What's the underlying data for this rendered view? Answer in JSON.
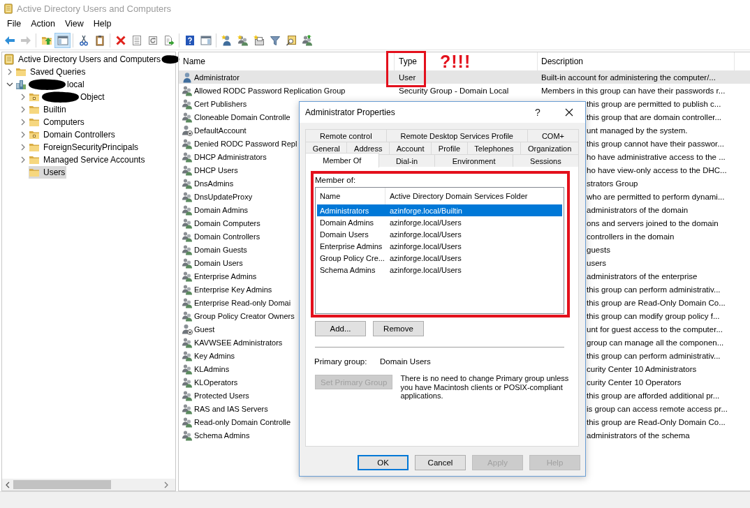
{
  "window": {
    "title": "Active Directory Users and Computers"
  },
  "menu": [
    {
      "label": "File"
    },
    {
      "label": "Action"
    },
    {
      "label": "View"
    },
    {
      "label": "Help"
    }
  ],
  "toolbar": [
    {
      "buttons": [
        {
          "kind": "back",
          "pressed": false,
          "disabled": false
        },
        {
          "kind": "forward",
          "pressed": false,
          "disabled": true
        }
      ]
    },
    {
      "buttons": [
        {
          "kind": "up",
          "pressed": false,
          "disabled": false
        },
        {
          "kind": "console_tree",
          "pressed": true,
          "disabled": false
        }
      ]
    },
    {
      "buttons": [
        {
          "kind": "cut",
          "pressed": false,
          "disabled": false
        },
        {
          "kind": "paste",
          "pressed": false,
          "disabled": false
        }
      ]
    },
    {
      "buttons": [
        {
          "kind": "delete",
          "pressed": false,
          "disabled": false
        },
        {
          "kind": "properties",
          "pressed": false,
          "disabled": false
        },
        {
          "kind": "refresh",
          "pressed": false,
          "disabled": false
        },
        {
          "kind": "export",
          "pressed": false,
          "disabled": false
        }
      ]
    },
    {
      "buttons": [
        {
          "kind": "help",
          "pressed": false,
          "disabled": false
        },
        {
          "kind": "action_pane",
          "pressed": false,
          "disabled": false
        }
      ]
    },
    {
      "buttons": [
        {
          "kind": "new_user",
          "pressed": false,
          "disabled": false
        },
        {
          "kind": "new_group",
          "pressed": false,
          "disabled": false
        },
        {
          "kind": "new_ou",
          "pressed": false,
          "disabled": false
        },
        {
          "kind": "filter",
          "pressed": false,
          "disabled": false
        },
        {
          "kind": "find",
          "pressed": false,
          "disabled": false
        },
        {
          "kind": "add_to_group",
          "pressed": false,
          "disabled": false
        }
      ]
    }
  ],
  "tree": {
    "items": [
      {
        "label": "Active Directory Users and Computers",
        "kind": "console",
        "selected": false,
        "redacted_before": false,
        "redacted_after": true,
        "children": [
          {
            "label": "Saved Queries",
            "kind": "folder",
            "expanded": false,
            "selected": false,
            "redacted_before": false,
            "redacted_after": false
          },
          {
            "label": "local",
            "kind": "domain",
            "expanded": true,
            "selected": false,
            "redacted_before": true,
            "redacted_after": false,
            "children": [
              {
                "label": "Object",
                "kind": "ou",
                "expanded": false,
                "selected": false,
                "redacted_before": true,
                "redacted_after": false
              },
              {
                "label": "Builtin",
                "kind": "folder",
                "expanded": false,
                "selected": false,
                "redacted_before": false,
                "redacted_after": false
              },
              {
                "label": "Computers",
                "kind": "folder",
                "expanded": false,
                "selected": false,
                "redacted_before": false,
                "redacted_after": false
              },
              {
                "label": "Domain Controllers",
                "kind": "ou",
                "expanded": false,
                "selected": false,
                "redacted_before": false,
                "redacted_after": false
              },
              {
                "label": "ForeignSecurityPrincipals",
                "kind": "folder",
                "expanded": false,
                "selected": false,
                "redacted_before": false,
                "redacted_after": false
              },
              {
                "label": "Managed Service Accounts",
                "kind": "folder",
                "expanded": false,
                "selected": false,
                "redacted_before": false,
                "redacted_after": false
              },
              {
                "label": "Users",
                "kind": "folder",
                "selected": true,
                "redacted_before": false,
                "redacted_after": false
              }
            ]
          }
        ]
      }
    ]
  },
  "list": {
    "columns": [
      {
        "label": "Name",
        "highlighted": false
      },
      {
        "label": "Type",
        "highlighted": true,
        "annotation": "?!!!"
      },
      {
        "label": "Description",
        "highlighted": false
      }
    ],
    "rows": [
      {
        "name": "Administrator",
        "kind": "user",
        "type": "User",
        "description": "Built-in account for administering the computer/...",
        "selected": true
      },
      {
        "name": "Allowed RODC Password Replication Group",
        "kind": "group",
        "type": "Security Group - Domain Local",
        "description": "Members in this group can have their passwords r...",
        "selected": false
      },
      {
        "name": "Cert Publishers",
        "kind": "group",
        "description": "this group are permitted to publish c...",
        "selected": false
      },
      {
        "name": "Cloneable Domain Controlle",
        "kind": "group",
        "description": "this group that are domain controller...",
        "selected": false
      },
      {
        "name": "DefaultAccount",
        "kind": "disabled_user",
        "description": "unt managed by the system.",
        "selected": false
      },
      {
        "name": "Denied RODC Password Repl",
        "kind": "group",
        "description": "this group cannot have their passwor...",
        "selected": false
      },
      {
        "name": "DHCP Administrators",
        "kind": "group",
        "description": "ho have administrative access to the ...",
        "selected": false
      },
      {
        "name": "DHCP Users",
        "kind": "group",
        "description": "ho have view-only access to the DHC...",
        "selected": false
      },
      {
        "name": "DnsAdmins",
        "kind": "group",
        "description": "strators Group",
        "selected": false
      },
      {
        "name": "DnsUpdateProxy",
        "kind": "group",
        "description": "who are permitted to perform dynami...",
        "selected": false
      },
      {
        "name": "Domain Admins",
        "kind": "group",
        "description": "administrators of the domain",
        "selected": false
      },
      {
        "name": "Domain Computers",
        "kind": "group",
        "description": "ons and servers joined to the domain",
        "selected": false
      },
      {
        "name": "Domain Controllers",
        "kind": "group",
        "description": "controllers in the domain",
        "selected": false
      },
      {
        "name": "Domain Guests",
        "kind": "group",
        "description": "guests",
        "selected": false
      },
      {
        "name": "Domain Users",
        "kind": "group",
        "description": "users",
        "selected": false
      },
      {
        "name": "Enterprise Admins",
        "kind": "group",
        "description": "administrators of the enterprise",
        "selected": false
      },
      {
        "name": "Enterprise Key Admins",
        "kind": "group",
        "description": "this group can perform administrativ...",
        "selected": false
      },
      {
        "name": "Enterprise Read-only Domai",
        "kind": "group",
        "description": "this group are Read-Only Domain Co...",
        "selected": false
      },
      {
        "name": "Group Policy Creator Owners",
        "kind": "group",
        "description": "this group can modify group policy f...",
        "selected": false
      },
      {
        "name": "Guest",
        "kind": "disabled_user",
        "description": "unt for guest access to the computer...",
        "selected": false
      },
      {
        "name": "KAVWSEE Administrators",
        "kind": "group",
        "description": "group can manage all the componen...",
        "selected": false
      },
      {
        "name": "Key Admins",
        "kind": "group",
        "description": "this group can perform administrativ...",
        "selected": false
      },
      {
        "name": "KLAdmins",
        "kind": "group",
        "description": "curity Center 10 Administrators",
        "selected": false
      },
      {
        "name": "KLOperators",
        "kind": "group",
        "description": "curity Center 10 Operators",
        "selected": false
      },
      {
        "name": "Protected Users",
        "kind": "group",
        "description": "this group are afforded additional pr...",
        "selected": false
      },
      {
        "name": "RAS and IAS Servers",
        "kind": "group",
        "description": "is group can access remote access pr...",
        "selected": false
      },
      {
        "name": "Read-only Domain Controlle",
        "kind": "group",
        "description": "this group are Read-Only Domain Co...",
        "selected": false
      },
      {
        "name": "Schema Admins",
        "kind": "group",
        "description": "administrators of the schema",
        "selected": false
      }
    ]
  },
  "dialog": {
    "title": "Administrator Properties",
    "help": "?",
    "tab_rows": [
      {
        "tabs": [
          {
            "label": "Remote control",
            "selected": false
          },
          {
            "label": "Remote Desktop Services Profile",
            "selected": false
          },
          {
            "label": "COM+",
            "selected": false
          }
        ]
      },
      {
        "tabs": [
          {
            "label": "General",
            "selected": false
          },
          {
            "label": "Address",
            "selected": false
          },
          {
            "label": "Account",
            "selected": false
          },
          {
            "label": "Profile",
            "selected": false
          },
          {
            "label": "Telephones",
            "selected": false
          },
          {
            "label": "Organization",
            "selected": false
          }
        ]
      },
      {
        "tabs": [
          {
            "label": "Member Of",
            "selected": true
          },
          {
            "label": "Dial-in",
            "selected": false
          },
          {
            "label": "Environment",
            "selected": false
          },
          {
            "label": "Sessions",
            "selected": false
          }
        ]
      }
    ],
    "member_of": {
      "label": "Member of:",
      "highlighted": true,
      "columns": [
        {
          "label": "Name"
        },
        {
          "label": "Active Directory Domain Services Folder"
        }
      ],
      "rows": [
        {
          "name": "Administrators",
          "folder": "azinforge.local/Builtin",
          "selected": true
        },
        {
          "name": "Domain Admins",
          "folder": "azinforge.local/Users",
          "selected": false
        },
        {
          "name": "Domain Users",
          "folder": "azinforge.local/Users",
          "selected": false
        },
        {
          "name": "Enterprise Admins",
          "folder": "azinforge.local/Users",
          "selected": false
        },
        {
          "name": "Group Policy Cre...",
          "folder": "azinforge.local/Users",
          "selected": false
        },
        {
          "name": "Schema Admins",
          "folder": "azinforge.local/Users",
          "selected": false
        }
      ]
    },
    "actions": [
      {
        "label": "Add..."
      },
      {
        "label": "Remove"
      }
    ],
    "primary_group": {
      "label": "Primary group:",
      "value": "Domain Users"
    },
    "set_primary": {
      "label": "Set Primary Group",
      "disabled": true
    },
    "note": "There is no need to change Primary group unless you have Macintosh clients or POSIX-compliant applications.",
    "buttons": [
      {
        "label": "OK",
        "focused": true,
        "disabled": false
      },
      {
        "label": "Cancel",
        "focused": false,
        "disabled": false
      },
      {
        "label": "Apply",
        "focused": false,
        "disabled": true
      },
      {
        "label": "Help",
        "focused": false,
        "disabled": true
      }
    ]
  }
}
